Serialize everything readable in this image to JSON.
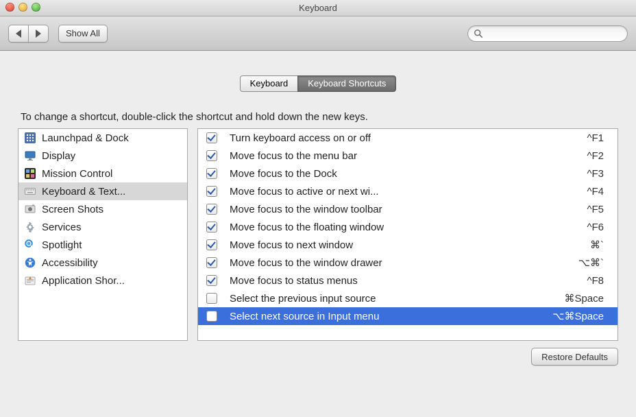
{
  "window": {
    "title": "Keyboard"
  },
  "toolbar": {
    "show_all_label": "Show All",
    "search_placeholder": ""
  },
  "tabs": {
    "keyboard": "Keyboard",
    "shortcuts": "Keyboard Shortcuts"
  },
  "hint": "To change a shortcut, double-click the shortcut and hold down the new keys.",
  "categories": [
    {
      "label": "Launchpad & Dock",
      "icon": "launchpad",
      "selected": false
    },
    {
      "label": "Display",
      "icon": "display",
      "selected": false
    },
    {
      "label": "Mission Control",
      "icon": "mission",
      "selected": false
    },
    {
      "label": "Keyboard & Text...",
      "icon": "keyboard",
      "selected": true
    },
    {
      "label": "Screen Shots",
      "icon": "screenshot",
      "selected": false
    },
    {
      "label": "Services",
      "icon": "services",
      "selected": false
    },
    {
      "label": "Spotlight",
      "icon": "spotlight",
      "selected": false
    },
    {
      "label": "Accessibility",
      "icon": "access",
      "selected": false
    },
    {
      "label": "Application Shor...",
      "icon": "appshort",
      "selected": false
    }
  ],
  "shortcuts": [
    {
      "checked": true,
      "label": "Turn keyboard access on or off",
      "key": "^F1",
      "selected": false
    },
    {
      "checked": true,
      "label": "Move focus to the menu bar",
      "key": "^F2",
      "selected": false
    },
    {
      "checked": true,
      "label": "Move focus to the Dock",
      "key": "^F3",
      "selected": false
    },
    {
      "checked": true,
      "label": "Move focus to active or next wi...",
      "key": "^F4",
      "selected": false
    },
    {
      "checked": true,
      "label": "Move focus to the window toolbar",
      "key": "^F5",
      "selected": false
    },
    {
      "checked": true,
      "label": "Move focus to the floating window",
      "key": "^F6",
      "selected": false
    },
    {
      "checked": true,
      "label": "Move focus to next window",
      "key": "⌘`",
      "selected": false
    },
    {
      "checked": true,
      "label": "Move focus to the window drawer",
      "key": "⌥⌘`",
      "selected": false
    },
    {
      "checked": true,
      "label": "Move focus to status menus",
      "key": "^F8",
      "selected": false
    },
    {
      "checked": false,
      "label": "Select the previous input source",
      "key": "⌘Space",
      "selected": false
    },
    {
      "checked": false,
      "label": "Select next source in Input menu",
      "key": "⌥⌘Space",
      "selected": true
    }
  ],
  "footer": {
    "restore_label": "Restore Defaults"
  }
}
